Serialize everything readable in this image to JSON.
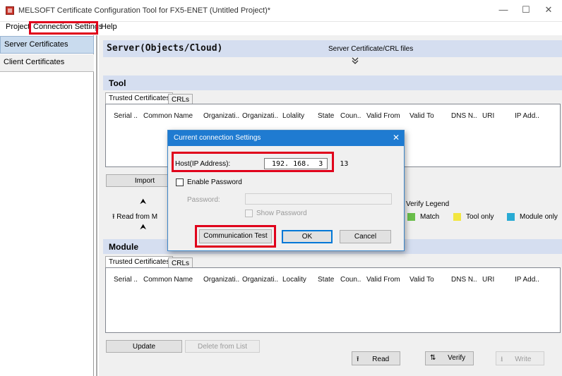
{
  "window": {
    "title": "MELSOFT Certificate Configuration Tool for FX5-ENET (Untitled Project)*",
    "minimize": "—",
    "maximize": "☐",
    "close": "✕"
  },
  "menu": [
    "Project",
    "Connection Settings",
    "Help"
  ],
  "sidebar": {
    "items": [
      {
        "label": "Server Certificates",
        "active": true
      },
      {
        "label": "Client Certificates",
        "active": false
      }
    ]
  },
  "server": {
    "title": "Server(Objects/Cloud)",
    "files_label": "Server Certificate/CRL files",
    "expand_icon": "double-chevron-down-icon"
  },
  "tool": {
    "title": "Tool",
    "tabs": [
      "Trusted Certificates",
      "CRLs"
    ],
    "columns": [
      "Serial ..",
      "Common Name",
      "Organizati..",
      "Organizati..",
      "Lolality",
      "State",
      "Coun..",
      "Valid From",
      "Valid To",
      "DNS N..",
      "URI",
      "IP Add.."
    ],
    "import_button": "Import",
    "read_from_label": "Read from M",
    "up_icon_1": "⮝",
    "up_icon_2": "⮝",
    "verify_legend": "Verify Legend",
    "legend": [
      {
        "label": "Match",
        "color": "#6abf4b"
      },
      {
        "label": "Tool only",
        "color": "#f2e640"
      },
      {
        "label": "Module only",
        "color": "#29abd4"
      }
    ]
  },
  "module": {
    "title": "Module",
    "tabs": [
      "Trusted Certificates",
      "CRLs"
    ],
    "columns": [
      "Serial ..",
      "Common Name",
      "Organizati..",
      "Organizati..",
      "Locality",
      "State",
      "Coun..",
      "Valid From",
      "Valid To",
      "DNS N..",
      "URI",
      "IP Add.."
    ],
    "update_button": "Update",
    "delete_button": "Delete from List",
    "read_button": "Read",
    "verify_button": "Verify",
    "write_button": "Write"
  },
  "dialog": {
    "title": "Current connection Settings",
    "host_label": "Host(IP Address):",
    "ip_address": "192. 168.  3  . 13",
    "enable_password_label": "Enable Password",
    "password_label": "Password:",
    "password_value": "",
    "show_password_label": "Show Password",
    "communication_test_button": "Communication Test",
    "ok_button": "OK",
    "cancel_button": "Cancel"
  },
  "colors": {
    "highlight": "#e0001b",
    "dialog_title_bar": "#1f7bd1",
    "section_bar": "#d5def0"
  }
}
